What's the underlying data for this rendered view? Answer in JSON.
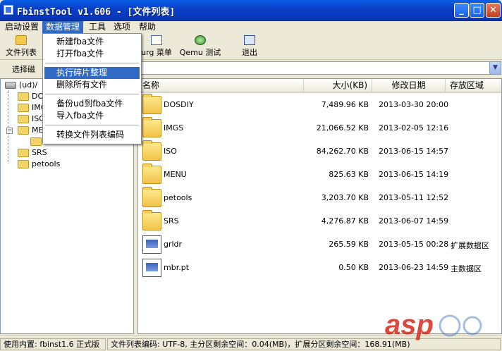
{
  "window": {
    "title": "FbinstTool v1.606 - [文件列表]",
    "controls": {
      "minimize": "_",
      "maximize": "□",
      "close": "✕"
    }
  },
  "menubar": [
    "启动设置",
    "数据管理",
    "工具",
    "选项",
    "帮助"
  ],
  "toolbar": {
    "file_list": "文件列表",
    "grub_menu": "Grub 菜单",
    "grub_menu_visible": "urg 菜单",
    "qemu_test": "Qemu 测试",
    "exit": "退出"
  },
  "address": {
    "label": "选择磁盘",
    "label_visible": "选择磁",
    "dropdown_arrow": "▼"
  },
  "dropdown_menu": {
    "items": [
      "新建fba文件",
      "打开fba文件",
      "执行碎片整理",
      "删除所有文件",
      "备份ud到fba文件",
      "导入fba文件",
      "转换文件列表编码"
    ],
    "highlighted_index": 2
  },
  "tree": {
    "root": "(ud)/",
    "expander_collapse": "−",
    "expander_expand": "+",
    "children": [
      "DOSDIY",
      "IMGS",
      "ISO",
      "MENU",
      "SRS",
      "petools"
    ],
    "children_visible": [
      "DOS",
      "IMG",
      "ISO",
      "MEN",
      "SRS",
      "petools"
    ]
  },
  "list": {
    "columns": [
      "名称",
      "大小(KB)",
      "修改日期",
      "存放区域"
    ],
    "rows": [
      {
        "type": "folder",
        "name": "DOSDIY",
        "size": "7,489.96 KB",
        "date": "2013-03-30 20:00",
        "area": ""
      },
      {
        "type": "folder",
        "name": "IMGS",
        "size": "21,066.52 KB",
        "date": "2013-02-05 12:16",
        "area": ""
      },
      {
        "type": "folder",
        "name": "ISO",
        "size": "84,262.70 KB",
        "date": "2013-06-15 14:57",
        "area": ""
      },
      {
        "type": "folder",
        "name": "MENU",
        "size": "825.63 KB",
        "date": "2013-06-15 14:19",
        "area": ""
      },
      {
        "type": "folder",
        "name": "petools",
        "size": "3,203.70 KB",
        "date": "2013-05-11 12:52",
        "area": ""
      },
      {
        "type": "folder",
        "name": "SRS",
        "size": "4,276.87 KB",
        "date": "2013-06-07 14:59",
        "area": ""
      },
      {
        "type": "file",
        "name": "grldr",
        "size": "265.59 KB",
        "date": "2013-05-15 00:28",
        "area": "扩展数据区"
      },
      {
        "type": "file",
        "name": "mbr.pt",
        "size": "0.50 KB",
        "date": "2013-06-23 14:59",
        "area": "主数据区"
      }
    ]
  },
  "status": {
    "left": "使用内置: fbinst1.6 正式版",
    "right": "文件列表编码: UTF-8, 主分区剩余空间：0.04(MB)，扩展分区剩余空间：168.91(MB)"
  },
  "watermark": "asp"
}
